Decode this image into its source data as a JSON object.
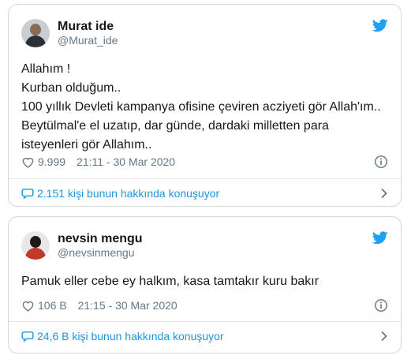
{
  "colors": {
    "twitter_blue": "#1da1f2",
    "link_blue": "#1b95e0",
    "secondary_text": "#657786",
    "border": "#cfd9de"
  },
  "tweets": [
    {
      "author": {
        "name": "Murat ide",
        "handle": "@Murat_ide"
      },
      "text_lines": [
        "Allahım !",
        "Kurban olduğum..",
        "100 yıllık Devleti kampanya ofisine çeviren acziyeti gör Allah'ım..",
        "Beytülmal'e el uzatıp, dar günde, dardaki milletten para",
        "isteyenleri gör Allahım.."
      ],
      "likes": "9.999",
      "timestamp": "21:11 - 30 Mar 2020",
      "conversation": "2.151 kişi bunun hakkında konuşuyor",
      "icons": [
        "twitter-bird-icon",
        "heart-icon",
        "info-icon",
        "speech-bubble-icon",
        "chevron-right-icon"
      ]
    },
    {
      "author": {
        "name": "nevsin mengu",
        "handle": "@nevsinmengu"
      },
      "text_lines": [
        "Pamuk eller cebe ey halkım, kasa tamtakır kuru bakır"
      ],
      "likes": "106 B",
      "timestamp": "21:15 - 30 Mar 2020",
      "conversation": "24,6 B kişi bunun hakkında konuşuyor",
      "icons": [
        "twitter-bird-icon",
        "heart-icon",
        "info-icon",
        "speech-bubble-icon",
        "chevron-right-icon"
      ]
    }
  ]
}
